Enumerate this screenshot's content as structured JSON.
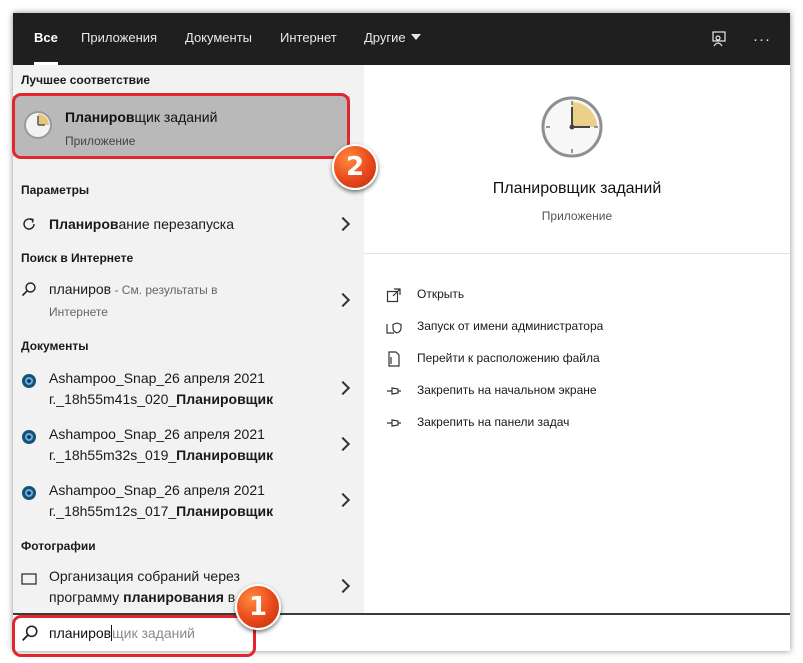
{
  "tabs": [
    {
      "label": "Все",
      "active": true
    },
    {
      "label": "Приложения"
    },
    {
      "label": "Документы"
    },
    {
      "label": "Интернет"
    },
    {
      "label": "Другие"
    }
  ],
  "topbar_icons": [
    "feedback-icon",
    "more-icon"
  ],
  "more_label": "···",
  "sections": {
    "best": "Лучшее соответствие",
    "settings": "Параметры",
    "web": "Поиск в Интернете",
    "documents": "Документы",
    "photos": "Фотографии"
  },
  "best_match": {
    "title_bold": "Планиров",
    "title_rest": "щик заданий",
    "subtitle": "Приложение"
  },
  "settings_item": {
    "bold": "Планиров",
    "rest": "ание перезапуска"
  },
  "web_item": {
    "query": "планиров",
    "suffix": " - ",
    "hint1": "См. результаты в",
    "hint2": "Интернете"
  },
  "documents": [
    {
      "line1": "Ashampoo_Snap_26 апреля 2021",
      "line2_plain": "г._18h55m41s_020_",
      "line2_bold": "Планировщик"
    },
    {
      "line1": "Ashampoo_Snap_26 апреля 2021",
      "line2_plain": "г._18h55m32s_019_",
      "line2_bold": "Планировщик"
    },
    {
      "line1": "Ashampoo_Snap_26 апреля 2021",
      "line2_plain": "г._18h55m12s_017_",
      "line2_bold": "Планировщик"
    }
  ],
  "photo_item": {
    "line1": "Организация собраний через",
    "line2_plain": "программу ",
    "line2_bold": "планирования",
    "line2_rest": " в Skype"
  },
  "detail": {
    "title": "Планировщик заданий",
    "subtitle": "Приложение",
    "actions": [
      {
        "label": "Открыть",
        "icon": "open-icon"
      },
      {
        "label": "Запуск от имени администратора",
        "icon": "admin-shield-icon"
      },
      {
        "label": "Перейти к расположению файла",
        "icon": "file-location-icon"
      },
      {
        "label": "Закрепить на начальном экране",
        "icon": "pin-icon"
      },
      {
        "label": "Закрепить на панели задач",
        "icon": "pin-icon"
      }
    ]
  },
  "search": {
    "typed": "планиров",
    "suggestion": "щик заданий"
  },
  "annotations": {
    "badge1": "1",
    "badge2": "2"
  },
  "colors": {
    "highlight": "#e2262e",
    "badge": "#e8471a",
    "topbar": "#1f1f1f",
    "selected": "#b9b9b9"
  }
}
